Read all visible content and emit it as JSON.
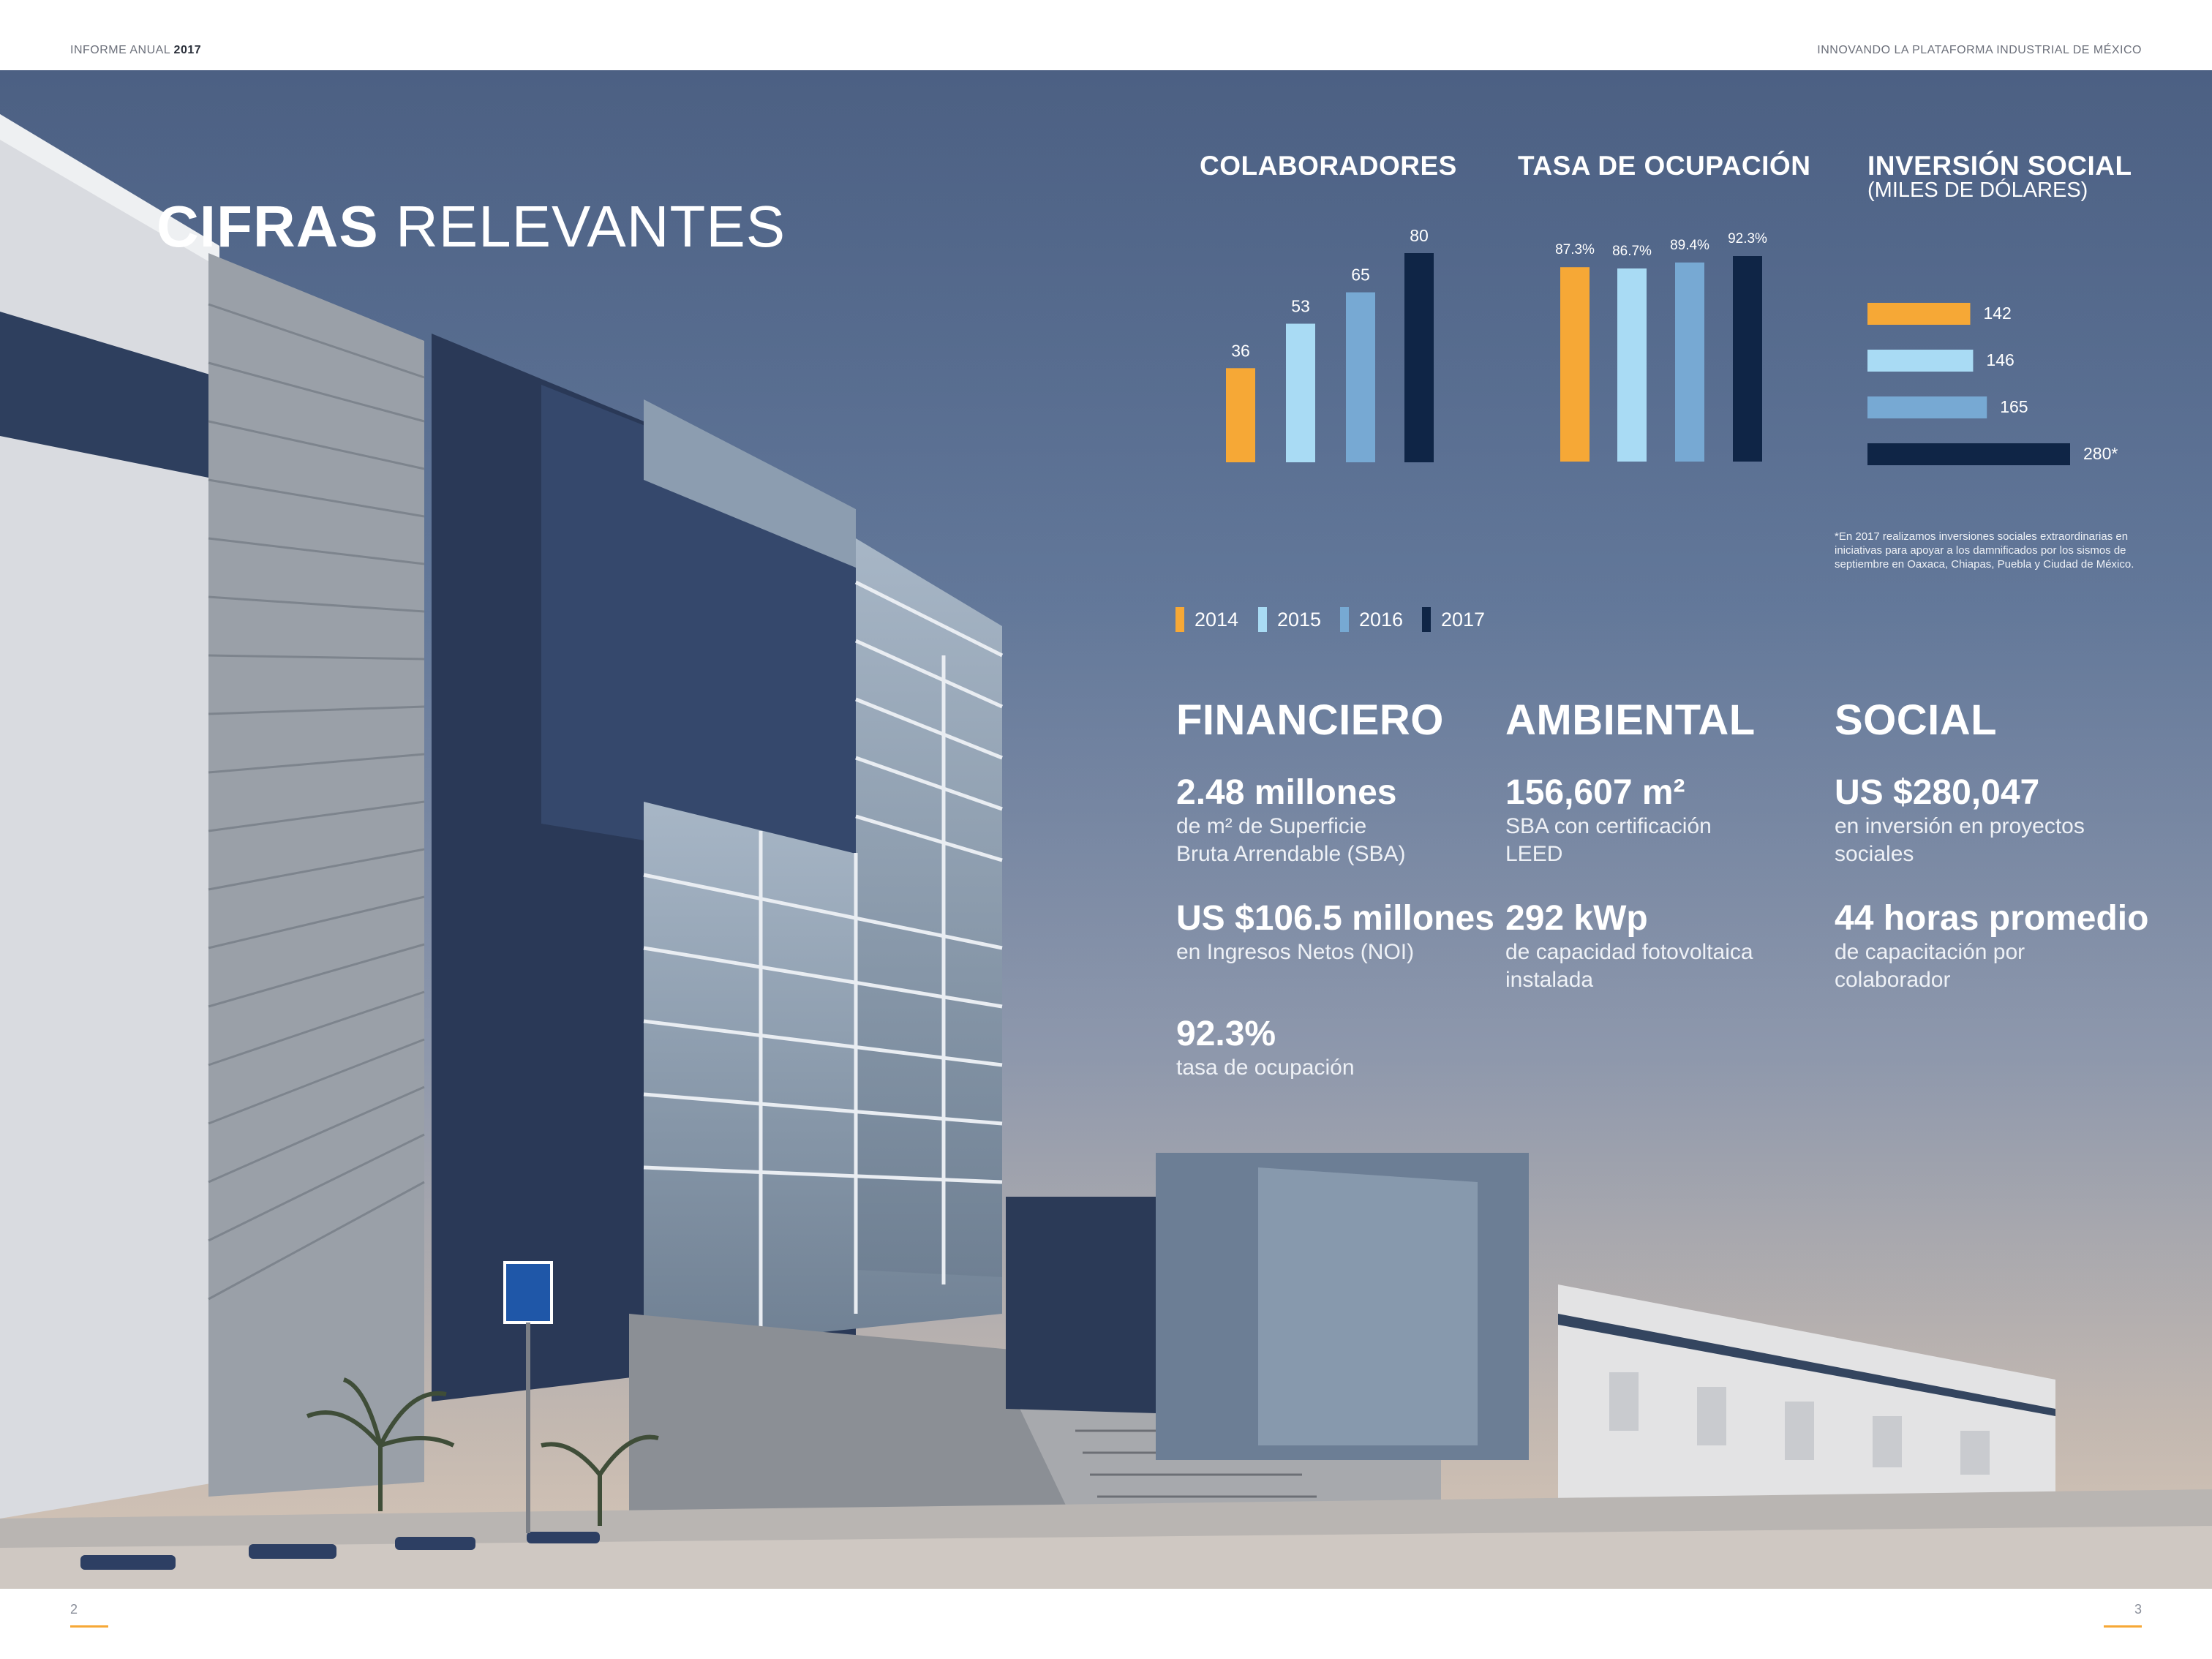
{
  "header": {
    "left_text": "INFORME ANUAL ",
    "left_year": "2017",
    "right_text": "INNOVANDO LA PLATAFORMA INDUSTRIAL DE MÉXICO"
  },
  "footer": {
    "page_left": "2",
    "page_right": "3"
  },
  "title": {
    "bold": "CIFRAS",
    "light": " RELEVANTES"
  },
  "colors": {
    "2014": "#f6a836",
    "2015": "#a9dbf4",
    "2016": "#77a9d3",
    "2017": "#0f2546",
    "accent": "#f6a836"
  },
  "legend": [
    {
      "year": "2014",
      "color": "#f6a836"
    },
    {
      "year": "2015",
      "color": "#a9dbf4"
    },
    {
      "year": "2016",
      "color": "#77a9d3"
    },
    {
      "year": "2017",
      "color": "#0f2546"
    }
  ],
  "chart_data": [
    {
      "type": "bar",
      "title": "COLABORADORES",
      "categories": [
        "2014",
        "2015",
        "2016",
        "2017"
      ],
      "values": [
        36,
        53,
        65,
        80
      ],
      "labels": [
        "36",
        "53",
        "65",
        "80"
      ]
    },
    {
      "type": "bar",
      "title": "TASA DE OCUPACIÓN",
      "categories": [
        "2014",
        "2015",
        "2016",
        "2017"
      ],
      "values": [
        87.3,
        86.7,
        89.4,
        92.3
      ],
      "labels": [
        "87.3%",
        "86.7%",
        "89.4%",
        "92.3%"
      ]
    },
    {
      "type": "bar",
      "orientation": "horizontal",
      "title": "INVERSIÓN SOCIAL",
      "subtitle": "(MILES DE DÓLARES)",
      "categories": [
        "2014",
        "2015",
        "2016",
        "2017"
      ],
      "values": [
        142,
        146,
        165,
        280
      ],
      "labels": [
        "142",
        "146",
        "165",
        "280*"
      ],
      "note": "*En 2017 realizamos inversiones sociales extraordinarias en iniciativas para apoyar a los damnificados por los sismos de septiembre en Oaxaca, Chiapas, Puebla y Ciudad de México."
    }
  ],
  "sections": {
    "financiero": {
      "title": "FINANCIERO",
      "kpis": [
        {
          "value": "2.48 millones",
          "desc1": "de m² de Superficie",
          "desc2": "Bruta Arrendable (SBA)"
        },
        {
          "value": "US $106.5 millones",
          "desc1": "en Ingresos Netos (NOI)",
          "desc2": ""
        },
        {
          "value": "92.3%",
          "desc1": "tasa de ocupación",
          "desc2": ""
        }
      ]
    },
    "ambiental": {
      "title": "AMBIENTAL",
      "kpis": [
        {
          "value": "156,607 m²",
          "desc1": "SBA con certificación",
          "desc2": "LEED"
        },
        {
          "value": "292 kWp",
          "desc1": "de capacidad fotovoltaica",
          "desc2": "instalada"
        }
      ]
    },
    "social": {
      "title": "SOCIAL",
      "kpis": [
        {
          "value": "US $280,047",
          "desc1": "en inversión en proyectos",
          "desc2": "sociales"
        },
        {
          "value": "44 horas promedio",
          "desc1": "de capacitación por",
          "desc2": "colaborador"
        }
      ]
    }
  }
}
